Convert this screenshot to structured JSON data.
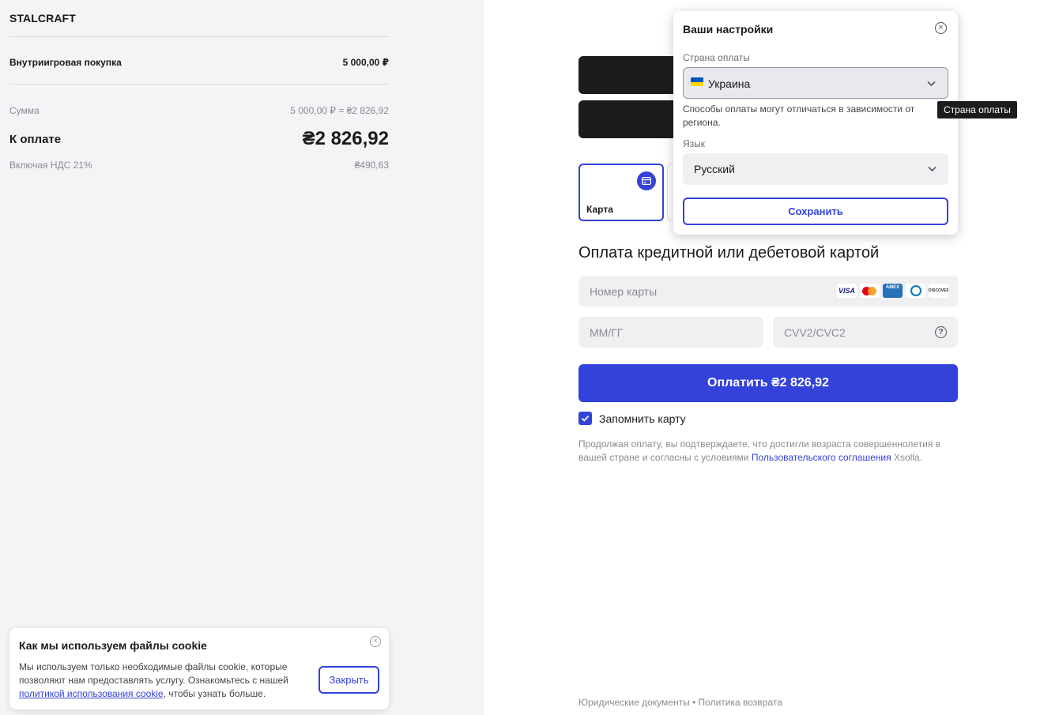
{
  "summary": {
    "brand": "STALCRAFT",
    "item_label": "Внутриигровая покупка",
    "item_price": "5 000,00 ₽",
    "sum_label": "Сумма",
    "sum_value": "5 000,00 ₽ = ₴2 826,92",
    "total_label": "К оплате",
    "total_value": "₴2 826,92",
    "vat_label": "Включая НДС 21%",
    "vat_value": "₴490,63"
  },
  "cookie": {
    "title": "Как мы используем файлы cookie",
    "text_before": "Мы используем только необходимые файлы cookie, которые позволяют нам предоставлять услугу. Ознакомьтесь с нашей ",
    "link": "политикой использования cookie",
    "text_after": ", чтобы узнать больше.",
    "close_button": "Закрыть",
    "close_icon": "close-circle-icon"
  },
  "payment": {
    "method_card_label": "Карта",
    "method_card_icon": "credit-card-icon",
    "title": "Оплата кредитной или дебетовой картой",
    "card_number_placeholder": "Номер карты",
    "expiry_placeholder": "ММ/ГГ",
    "cvv_placeholder": "CVV2/CVC2",
    "cvv_help": "?",
    "card_logos": [
      "VISA",
      "mastercard",
      "AMEX",
      "diners",
      "DISCOVER"
    ],
    "pay_button": "Оплатить ₴2 826,92",
    "remember_label": "Запомнить карту",
    "remember_checked": true,
    "terms_before": "Продолжая оплату, вы подтверждаете, что достигли возраста совершеннолетия в вашей стране и согласны с условиями ",
    "terms_link": "Пользовательского соглашения",
    "terms_after": " Xsolla.",
    "footer": "Юридические документы • Политика возврата"
  },
  "settings": {
    "title": "Ваши настройки",
    "country_label": "Страна оплаты",
    "country_value": "Украина",
    "note": "Способы оплаты могут отличаться в зависимости от региона.",
    "language_label": "Язык",
    "language_value": "Русский",
    "save_button": "Сохранить",
    "tooltip": "Страна оплаты"
  },
  "colors": {
    "accent": "#3342d9",
    "dark_button": "#1c1c1e",
    "panel_bg": "#f4f4f6"
  }
}
